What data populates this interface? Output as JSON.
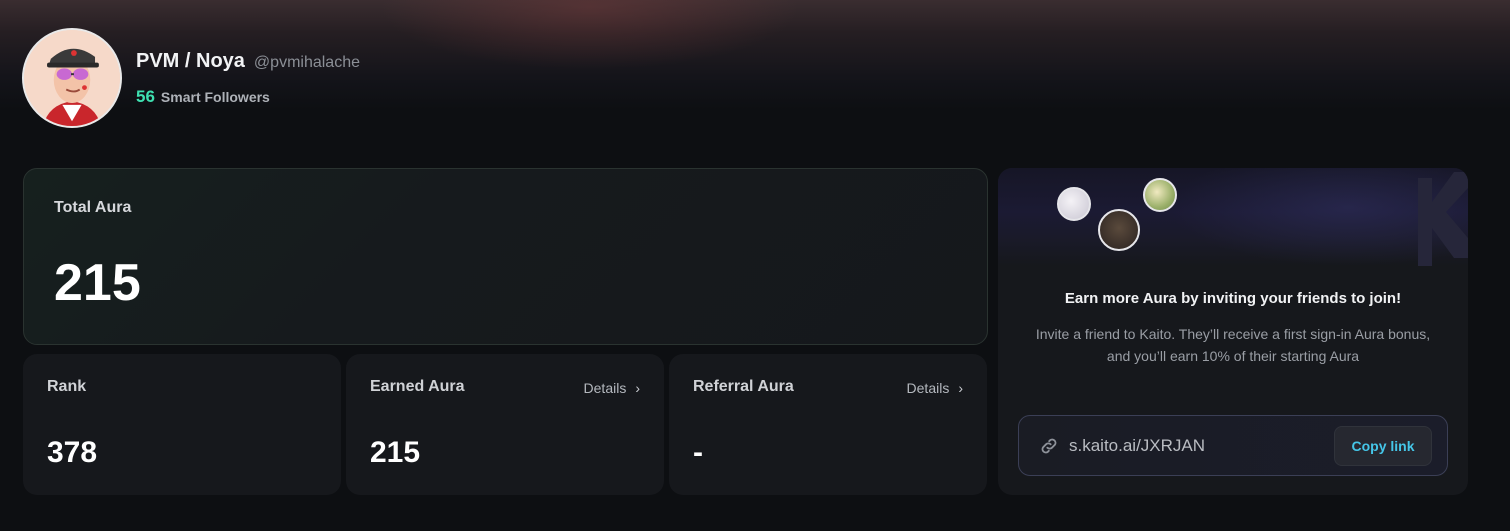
{
  "profile": {
    "display_name": "PVM / Noya",
    "handle": "@pvmihalache",
    "smart_followers_count": "56",
    "smart_followers_label": "Smart Followers"
  },
  "total_aura": {
    "label": "Total Aura",
    "value": "215"
  },
  "rank": {
    "label": "Rank",
    "value": "378"
  },
  "earned_aura": {
    "label": "Earned Aura",
    "details_label": "Details",
    "value": "215"
  },
  "referral_aura": {
    "label": "Referral Aura",
    "details_label": "Details",
    "value": "-"
  },
  "invite": {
    "title": "Earn more Aura by inviting your friends to join!",
    "description": "Invite a friend to Kaito. They’ll receive a first sign-in Aura bonus, and you’ll earn 10% of their starting Aura",
    "referral_link": "s.kaito.ai/JXRJAN",
    "copy_button_label": "Copy link"
  },
  "colors": {
    "accent_green": "#3ee0b0",
    "accent_cyan": "#45c6e8",
    "background": "#0d0f12",
    "card": "#16181c"
  },
  "icons": {
    "link": "link-icon",
    "chevron": "chevron-right-icon"
  }
}
